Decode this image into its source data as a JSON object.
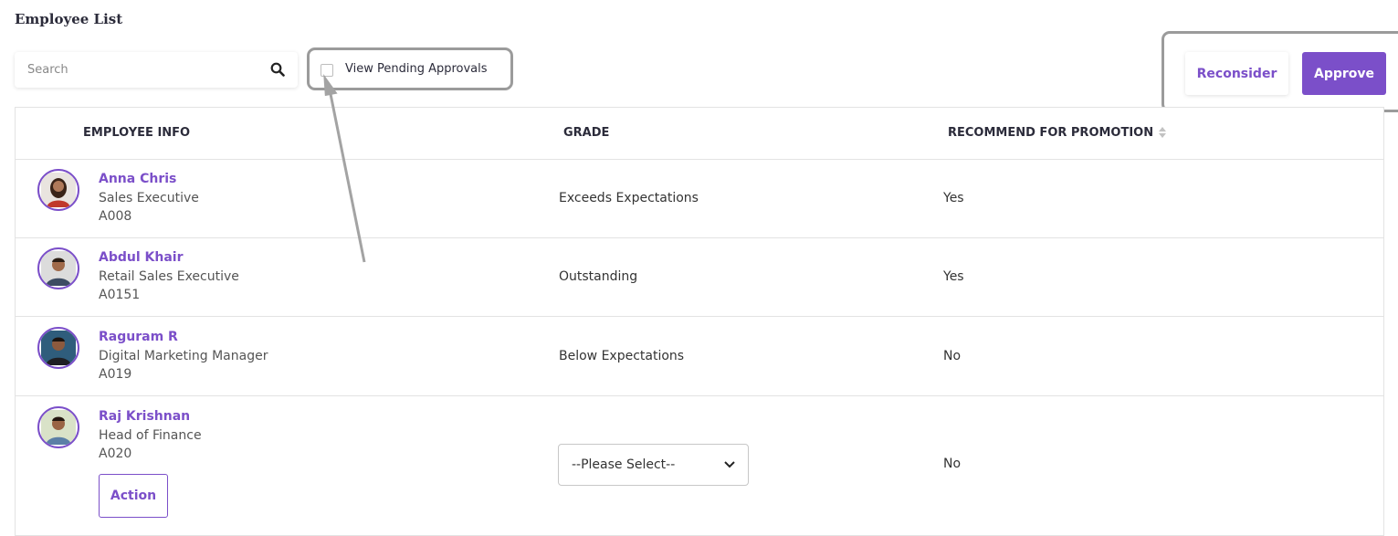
{
  "page": {
    "title": "Employee List"
  },
  "search": {
    "placeholder": "Search",
    "value": ""
  },
  "filters": {
    "pending_label": "View Pending Approvals",
    "pending_checked": false
  },
  "actions": {
    "reconsider_label": "Reconsider",
    "approve_label": "Approve"
  },
  "table": {
    "headers": {
      "employee": "EMPLOYEE INFO",
      "grade": "GRADE",
      "promotion": "RECOMMEND FOR PROMOTION"
    },
    "rows": [
      {
        "name": "Anna Chris",
        "role": "Sales Executive",
        "id": "A008",
        "grade": "Exceeds Expectations",
        "promotion": "Yes"
      },
      {
        "name": "Abdul Khair",
        "role": "Retail Sales Executive",
        "id": "A0151",
        "grade": "Outstanding",
        "promotion": "Yes"
      },
      {
        "name": "Raguram R",
        "role": "Digital Marketing Manager",
        "id": "A019",
        "grade": "Below Expectations",
        "promotion": "No"
      },
      {
        "name": "Raj Krishnan",
        "role": "Head of Finance",
        "id": "A020",
        "grade_select": "--Please Select--",
        "promotion": "No",
        "action_label": "Action"
      }
    ]
  },
  "colors": {
    "accent": "#7b4fc9",
    "highlight": "#9b9b9b"
  },
  "icons": {
    "search": "search-icon",
    "sort": "sort-icon",
    "dropdown": "chevron-down-icon"
  }
}
